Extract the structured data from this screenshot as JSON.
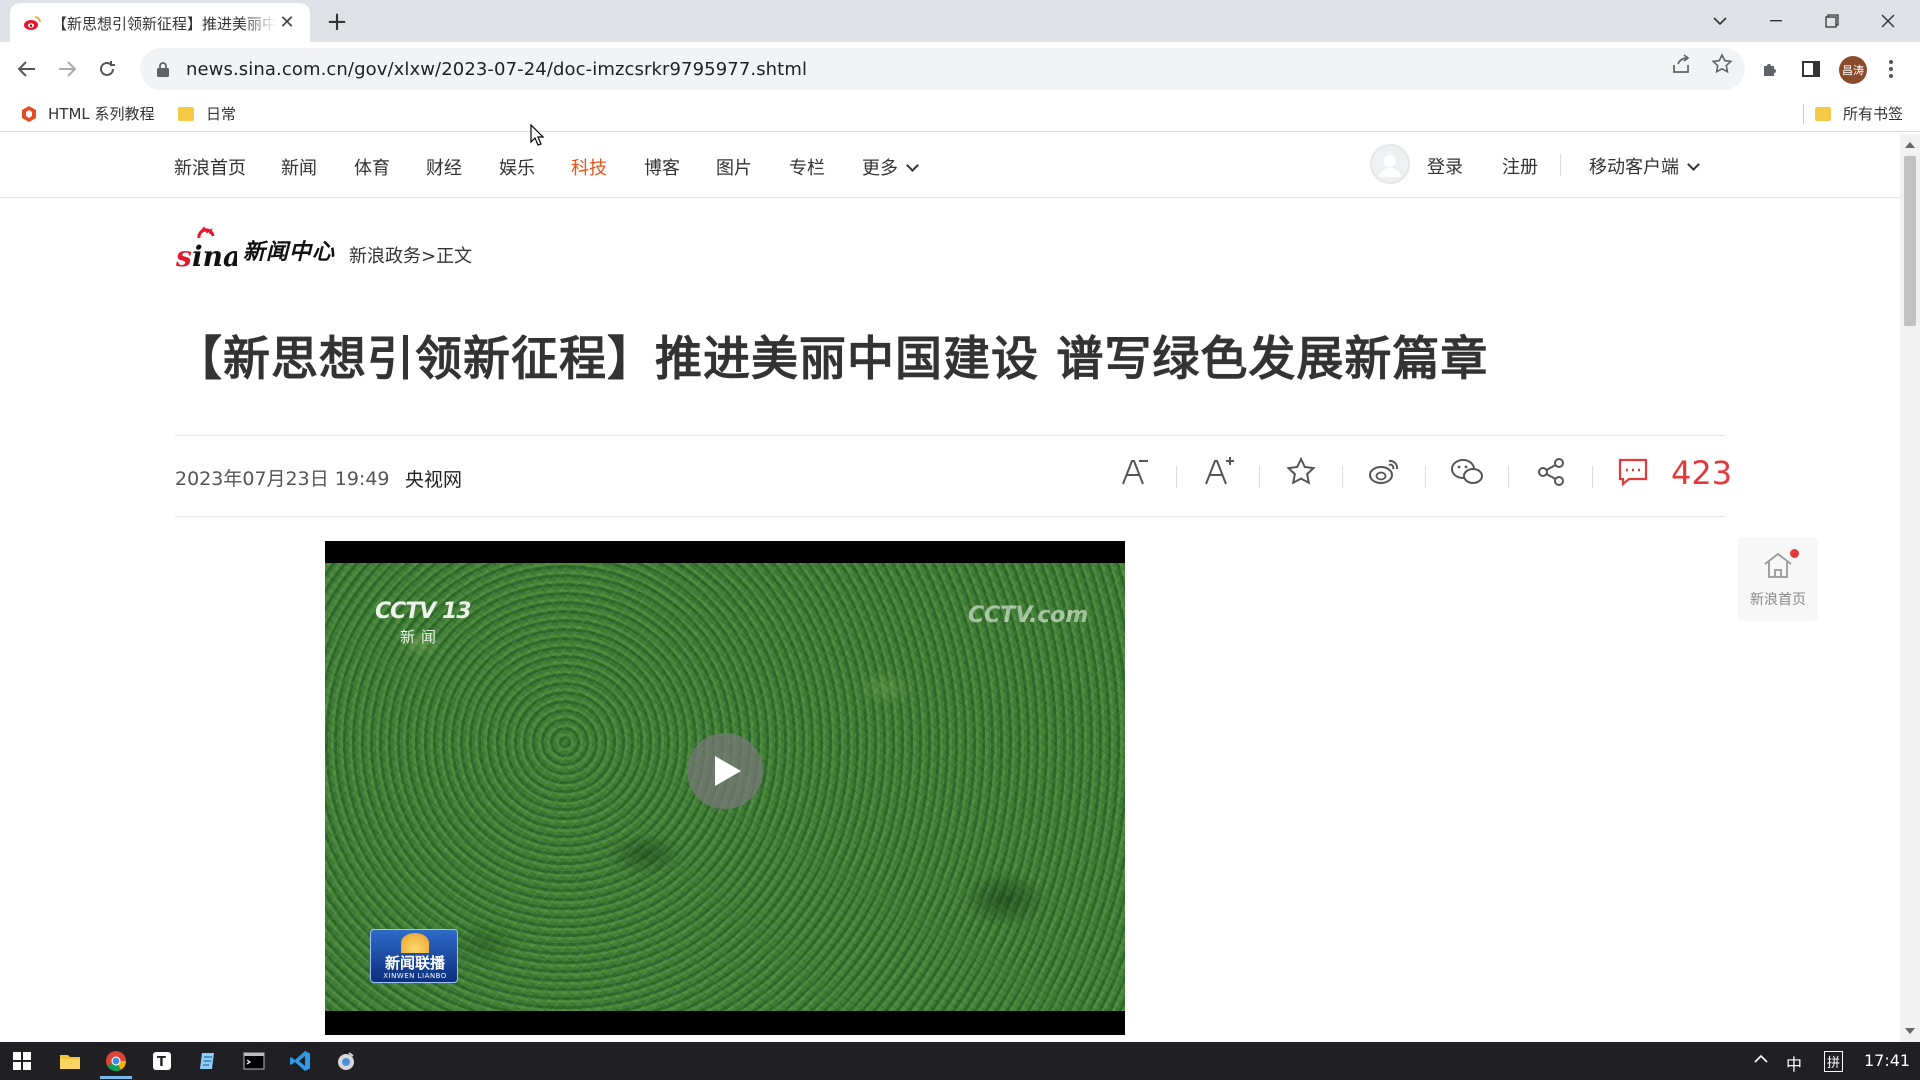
{
  "browser": {
    "tab_title": "【新思想引领新征程】推进美丽中国建设 谱写绿色发展新篇章",
    "url": "news.sina.com.cn/gov/xlxw/2023-07-24/doc-imzcsrkr9795977.shtml",
    "avatar_text": "昌涛",
    "bookmarks": [
      "HTML 系列教程",
      "日常"
    ],
    "all_bookmarks": "所有书签"
  },
  "nav": {
    "items": [
      "新浪首页",
      "新闻",
      "体育",
      "财经",
      "娱乐",
      "科技",
      "博客",
      "图片",
      "专栏"
    ],
    "active": "科技",
    "more": "更多",
    "login": "登录",
    "register": "注册",
    "mobile": "移动客户端"
  },
  "header": {
    "brand": "新闻中心",
    "breadcrumb": "新浪政务>正文"
  },
  "article": {
    "title": "【新思想引领新征程】推进美丽中国建设 谱写绿色发展新篇章",
    "date": "2023年07月23日 19:49",
    "source": "央视网",
    "comment_count": "423"
  },
  "video": {
    "channel_logo": "CCTV 13",
    "channel_sub": "新闻",
    "watermark": "CCTV.com",
    "program_title": "新闻联播",
    "program_sub": "XINWEN LIANBO"
  },
  "float_home": {
    "label": "新浪首页"
  },
  "taskbar": {
    "ime": "中",
    "ime2": "拼",
    "time": "17:41"
  },
  "colors": {
    "accent": "#e4531c",
    "comment_red": "#e4393c",
    "taskbar": "#1f1f24"
  }
}
